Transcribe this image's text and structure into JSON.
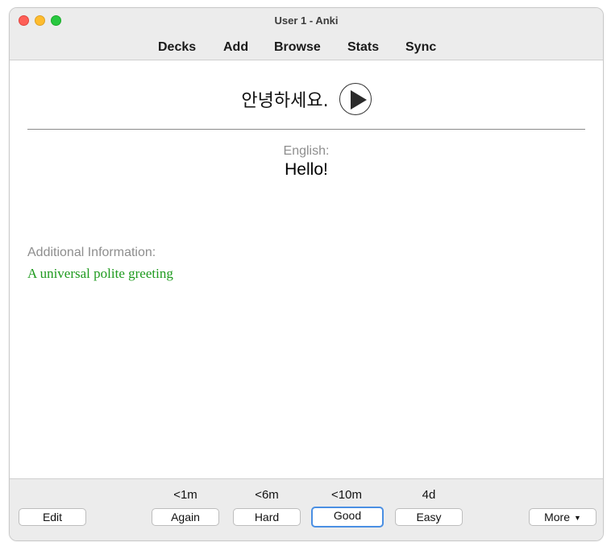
{
  "window": {
    "title": "User 1 - Anki"
  },
  "toolbar": {
    "decks": "Decks",
    "add": "Add",
    "browse": "Browse",
    "stats": "Stats",
    "sync": "Sync"
  },
  "card": {
    "front": "안녕하세요.",
    "english_label": "English:",
    "english_value": "Hello!",
    "additional_label": "Additional Information:",
    "additional_value": "A universal polite greeting",
    "additional_color": "#1e9a1e"
  },
  "answer": {
    "edit": "Edit",
    "again": {
      "label": "Again",
      "interval": "<1m"
    },
    "hard": {
      "label": "Hard",
      "interval": "<6m"
    },
    "good": {
      "label": "Good",
      "interval": "<10m"
    },
    "easy": {
      "label": "Easy",
      "interval": "4d"
    },
    "more": "More",
    "more_caret": "▼"
  },
  "colors": {
    "focus": "#4a8fe3",
    "close": "#fe5f57",
    "minimize": "#febc2e",
    "zoom": "#28c840"
  }
}
